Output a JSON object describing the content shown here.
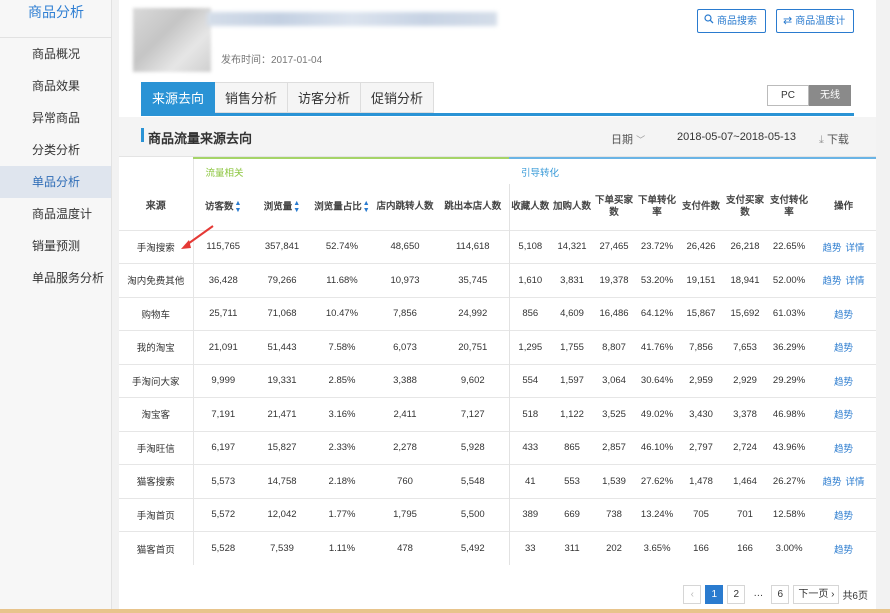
{
  "sidebar": {
    "title": "商品分析",
    "items": [
      {
        "label": "商品概况",
        "active": false
      },
      {
        "label": "商品效果",
        "active": false
      },
      {
        "label": "异常商品",
        "active": false
      },
      {
        "label": "分类分析",
        "active": false
      },
      {
        "label": "单品分析",
        "active": true
      },
      {
        "label": "商品温度计",
        "active": false
      },
      {
        "label": "销量预测",
        "active": false
      },
      {
        "label": "单品服务分析",
        "active": false
      }
    ]
  },
  "product": {
    "publish_time": "发布时间：2017-01-04"
  },
  "header_buttons": {
    "search": {
      "label": "商品搜索",
      "icon": "search-icon"
    },
    "thermometer": {
      "label": "商品温度计",
      "icon": "swap-icon"
    }
  },
  "tabs": [
    {
      "label": "来源去向",
      "active": true
    },
    {
      "label": "销售分析",
      "active": false
    },
    {
      "label": "访客分析",
      "active": false
    },
    {
      "label": "促销分析",
      "active": false
    }
  ],
  "device": {
    "pc": "PC",
    "wireless": "无线",
    "selected": "无线"
  },
  "section": {
    "title": "商品流量来源去向",
    "date_label": "日期",
    "date_range": "2018-05-07~2018-05-13",
    "download": "下载"
  },
  "table": {
    "groups": {
      "traffic": "流量相关",
      "convert": "引导转化"
    },
    "headers": {
      "source": "来源",
      "visitors": "访客数",
      "pageviews": "浏览量",
      "pv_ratio": "浏览量占比",
      "in_store_jump": "店内跳转人数",
      "out_store_jump": "跳出本店人数",
      "favorites": "收藏人数",
      "add_cart": "加购人数",
      "order_buyers": "下单买家数",
      "order_rate": "下单转化率",
      "pay_items": "支付件数",
      "pay_buyers": "支付买家数",
      "pay_rate": "支付转化率",
      "ops": "操作"
    },
    "op_labels": {
      "trend": "趋势",
      "detail": "详情"
    },
    "rows": [
      {
        "source": "手淘搜索",
        "c": [
          "115,765",
          "357,841",
          "52.74%",
          "48,650",
          "114,618",
          "5,108",
          "14,321",
          "27,465",
          "23.72%",
          "26,426",
          "26,218",
          "22.65%"
        ],
        "trend": "趋势",
        "detail": "详情"
      },
      {
        "source": "淘内免费其他",
        "c": [
          "36,428",
          "79,266",
          "11.68%",
          "10,973",
          "35,745",
          "1,610",
          "3,831",
          "19,378",
          "53.20%",
          "19,151",
          "18,941",
          "52.00%"
        ],
        "trend": "趋势",
        "detail": "详情"
      },
      {
        "source": "购物车",
        "c": [
          "25,711",
          "71,068",
          "10.47%",
          "7,856",
          "24,992",
          "856",
          "4,609",
          "16,486",
          "64.12%",
          "15,867",
          "15,692",
          "61.03%"
        ],
        "trend": "趋势",
        "detail": ""
      },
      {
        "source": "我的淘宝",
        "c": [
          "21,091",
          "51,443",
          "7.58%",
          "6,073",
          "20,751",
          "1,295",
          "1,755",
          "8,807",
          "41.76%",
          "7,856",
          "7,653",
          "36.29%"
        ],
        "trend": "趋势",
        "detail": ""
      },
      {
        "source": "手淘问大家",
        "c": [
          "9,999",
          "19,331",
          "2.85%",
          "3,388",
          "9,602",
          "554",
          "1,597",
          "3,064",
          "30.64%",
          "2,959",
          "2,929",
          "29.29%"
        ],
        "trend": "趋势",
        "detail": ""
      },
      {
        "source": "淘宝客",
        "c": [
          "7,191",
          "21,471",
          "3.16%",
          "2,411",
          "7,127",
          "518",
          "1,122",
          "3,525",
          "49.02%",
          "3,430",
          "3,378",
          "46.98%"
        ],
        "trend": "趋势",
        "detail": ""
      },
      {
        "source": "手淘旺信",
        "c": [
          "6,197",
          "15,827",
          "2.33%",
          "2,278",
          "5,928",
          "433",
          "865",
          "2,857",
          "46.10%",
          "2,797",
          "2,724",
          "43.96%"
        ],
        "trend": "趋势",
        "detail": ""
      },
      {
        "source": "猫客搜索",
        "c": [
          "5,573",
          "14,758",
          "2.18%",
          "760",
          "5,548",
          "41",
          "553",
          "1,539",
          "27.62%",
          "1,478",
          "1,464",
          "26.27%"
        ],
        "trend": "趋势",
        "detail": "详情"
      },
      {
        "source": "手淘首页",
        "c": [
          "5,572",
          "12,042",
          "1.77%",
          "1,795",
          "5,500",
          "389",
          "669",
          "738",
          "13.24%",
          "705",
          "701",
          "12.58%"
        ],
        "trend": "趋势",
        "detail": ""
      },
      {
        "source": "猫客首页",
        "c": [
          "5,528",
          "7,539",
          "1.11%",
          "478",
          "5,492",
          "33",
          "311",
          "202",
          "3.65%",
          "166",
          "166",
          "3.00%"
        ],
        "trend": "趋势",
        "detail": ""
      }
    ]
  },
  "pagination": {
    "prev": "‹",
    "pages": [
      "1",
      "2",
      "…",
      "6"
    ],
    "current": "1",
    "next": "下一页 ›",
    "total": "共6页"
  }
}
